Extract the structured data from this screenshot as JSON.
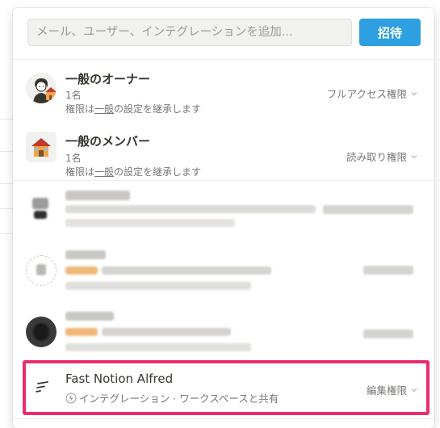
{
  "search": {
    "placeholder": "メール、ユーザー、インテグレーションを追加..."
  },
  "invite_label": "招待",
  "members": [
    {
      "name": "一般のオーナー",
      "count": "1名",
      "inherit_prefix": "権限は",
      "inherit_link": "一般",
      "inherit_suffix": "の設定を継承します",
      "permission": "フルアクセス権限",
      "avatar_icon": "person-icon"
    },
    {
      "name": "一般のメンバー",
      "count": "1名",
      "inherit_prefix": "権限は",
      "inherit_link": "一般",
      "inherit_suffix": "の設定を継承します",
      "permission": "読み取り権限",
      "avatar_icon": "house-icon"
    }
  ],
  "integration": {
    "name": "Fast Notion Alfred",
    "subtitle": "インテグレーション · ワークスペースと共有",
    "permission": "編集権限",
    "icon": "integration-logo-icon",
    "sub_icon": "lightning-icon"
  },
  "colors": {
    "accent": "#2e9fe0",
    "highlight": "#ec2d6a",
    "text_secondary": "#787774"
  }
}
